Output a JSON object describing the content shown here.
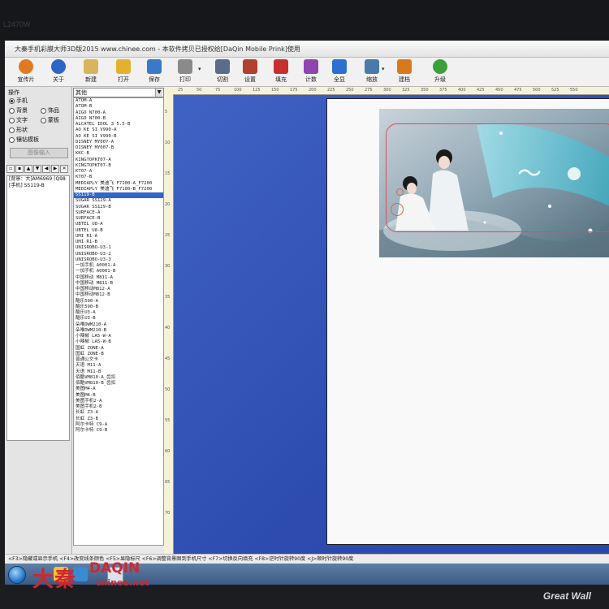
{
  "bezel": {
    "label": "L2470W",
    "brand": "Great Wall"
  },
  "window": {
    "title": "大秦手机彩膜大师3D版2015 www.chinee.com - 本软件拷贝已授权给[DaQin Mobile Prink]使用"
  },
  "toolbar": {
    "buttons": [
      {
        "label": "宣传片",
        "icon": "media-icon",
        "color": "#e07a1f"
      },
      {
        "label": "关于",
        "icon": "info-icon",
        "color": "#2d64c8"
      },
      {
        "label": "新建",
        "icon": "new-file-icon",
        "color": "#d8b45a"
      },
      {
        "label": "打开",
        "icon": "folder-open-icon",
        "color": "#e3b12e"
      },
      {
        "label": "保存",
        "icon": "save-icon",
        "color": "#3a78c8"
      },
      {
        "label": "打印",
        "icon": "printer-icon",
        "color": "#8a8a8a"
      },
      {
        "label": "切割",
        "icon": "cutter-icon",
        "color": "#5a6c8a"
      },
      {
        "label": "设置",
        "icon": "tools-icon",
        "color": "#b04030"
      },
      {
        "label": "填充",
        "icon": "fill-icon",
        "color": "#c8302f"
      },
      {
        "label": "计数",
        "icon": "counter-icon",
        "color": "#9044b0"
      },
      {
        "label": "全显",
        "icon": "fit-view-icon",
        "color": "#2c6fd0"
      },
      {
        "label": "缩放",
        "icon": "zoom-icon",
        "color": "#4a7aa8"
      },
      {
        "label": "建档",
        "icon": "archive-icon",
        "color": "#d87a1c"
      },
      {
        "label": "升级",
        "icon": "upgrade-icon",
        "color": "#3aa13a"
      }
    ]
  },
  "left_panel": {
    "section_label": "操作",
    "radios": [
      {
        "label": "手机",
        "selected": true
      },
      {
        "label": "饰品",
        "selected": false
      },
      {
        "label": "背景",
        "selected": false
      },
      {
        "label": "文字",
        "selected": false
      },
      {
        "label": "蒙板",
        "selected": false
      },
      {
        "label": "形状",
        "selected": false
      },
      {
        "label": "镶钻模板",
        "selected": false
      }
    ],
    "import_button": "图像输入",
    "layers": [
      "[背景：大]AM6969 (Q98",
      "[手机] SS119-B"
    ]
  },
  "model_panel": {
    "category": "其他",
    "models": [
      "ATOM-A",
      "ATOM-B",
      "AIGO N700-A",
      "AIGO N700-B",
      "ALCATEL IDOL 3 5.5-B",
      "AO KE SI V990-A",
      "AO KE SI V990-B",
      "DISNEY MY007-A",
      "DISNEY MY007-B",
      "KKC-B",
      "KINGTOPKT07-A",
      "KINGTOPKT07-B",
      "KT07-A",
      "KT07-B",
      "MEDIAPLY 美迪飞 F7100-A_F7200",
      "MEDIAPLY 美迪飞 F7100-B_F7200",
      "SS119-B",
      "SUGAR SS129-A",
      "SUGAR SS129-B",
      "SURFACE-A",
      "SURFACE-B",
      "UBTEL U8-A",
      "UBTEL U8-B",
      "UMI R1-A",
      "UMI R1-B",
      "UNISROBO-U3-1",
      "UNISROBO-U3-2",
      "UNISROBO-U3-3",
      "一加手机 A0001-A",
      "一加手机 A0001-B",
      "中国移动 M811-A",
      "中国移动 M811-B",
      "中国移动M812-A",
      "中国移动M812-B",
      "酷乐590-A",
      "酷乐590-B",
      "酷乐U3-A",
      "酷乐U3-B",
      "朵唯DWM210-A",
      "朵唯DWM210-B",
      "小辣椒 LA5-W-A",
      "小辣椒 LA5-W-B",
      "国虹 ZONE-A",
      "国虹 ZONE-B",
      "普通公文卡",
      "天语 M11-A",
      "天语 M11-B",
      "佰酷VM810-A_齿扣",
      "佰酷VM810-B_齿扣",
      "美图M4-A",
      "美图M4-B",
      "美图手机2-A",
      "美图手机2-B",
      "长虹 Z3-A",
      "长虹 Z3-B",
      "阿尔卡特 C9-A",
      "阿尔卡特 C9-B"
    ],
    "selected_model": "SS119-B"
  },
  "ruler_top": [
    "25",
    "50",
    "75",
    "100",
    "125",
    "150",
    "175",
    "200",
    "225",
    "250",
    "275",
    "300",
    "325",
    "350",
    "375",
    "400",
    "425",
    "450",
    "475",
    "500",
    "525",
    "550"
  ],
  "ruler_left": [
    "5",
    "10",
    "15",
    "20",
    "25",
    "30",
    "35",
    "40",
    "45",
    "50",
    "55",
    "60",
    "65",
    "70"
  ],
  "statusbar": {
    "text": "<F3>隐藏或显示手机  <F4>改变线条颜色  <F5>显隐标尺  <F6>调整背景图到手机尺寸  <F7>切换反向填充  <F8>逆时针旋转90度  <J>顺时针旋转90度"
  },
  "watermark": {
    "mark": "大秦",
    "brand": "DAQIN",
    "url": "chinee.net"
  },
  "colors": {
    "desk": "#3556b8",
    "selection": "#3165c8",
    "phone_outline": "#e04a5a"
  }
}
